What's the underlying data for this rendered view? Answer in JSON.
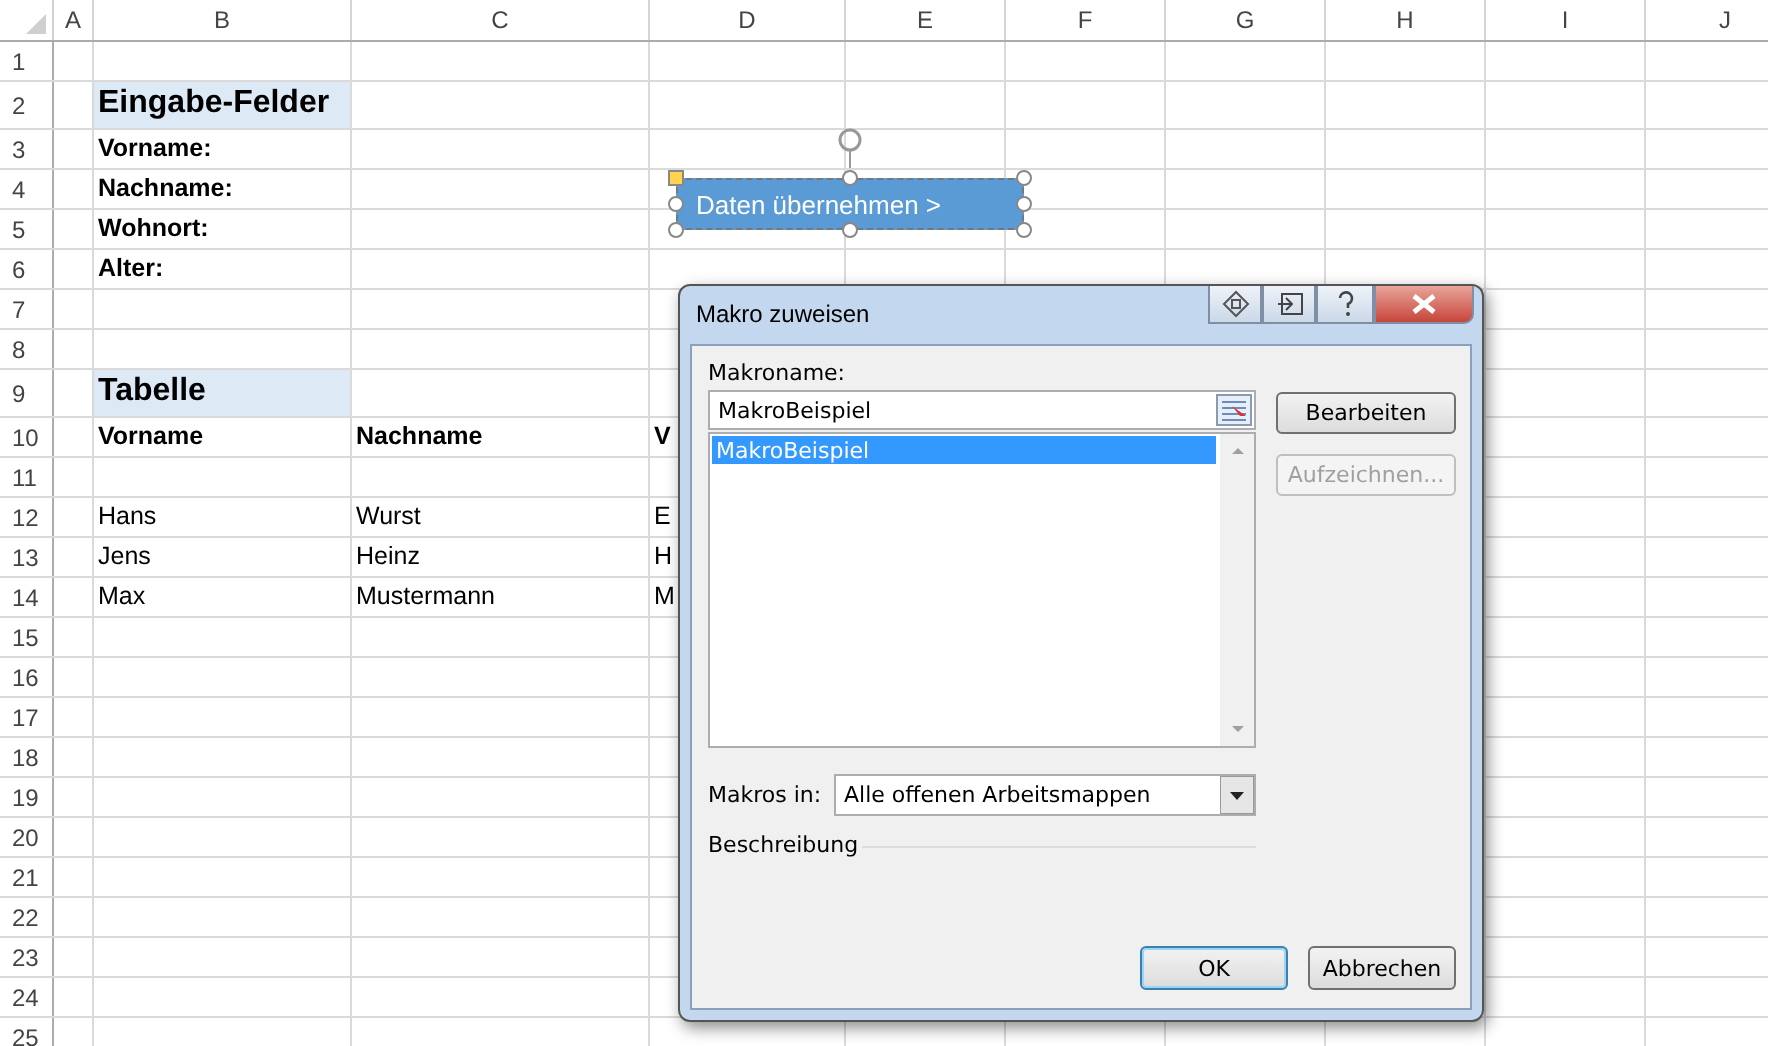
{
  "sheet": {
    "columns": [
      "A",
      "B",
      "C",
      "D",
      "E",
      "F",
      "G",
      "H",
      "I",
      "J"
    ],
    "rows": [
      {
        "number": "1",
        "kind": "plain"
      },
      {
        "number": "2",
        "kind": "heading",
        "b": "Eingabe-Felder"
      },
      {
        "number": "3",
        "kind": "bold",
        "b": "Vorname:"
      },
      {
        "number": "4",
        "kind": "bold",
        "b": "Nachname:"
      },
      {
        "number": "5",
        "kind": "bold",
        "b": "Wohnort:"
      },
      {
        "number": "6",
        "kind": "bold",
        "b": "Alter:"
      },
      {
        "number": "7",
        "kind": "plain"
      },
      {
        "number": "8",
        "kind": "plain"
      },
      {
        "number": "9",
        "kind": "heading",
        "b": "Tabelle"
      },
      {
        "number": "10",
        "kind": "bold",
        "b": "Vorname",
        "c": "Nachname",
        "d": "V"
      },
      {
        "number": "11",
        "kind": "plain"
      },
      {
        "number": "12",
        "kind": "plain",
        "b": "Hans",
        "c": "Wurst",
        "d": "E"
      },
      {
        "number": "13",
        "kind": "plain",
        "b": "Jens",
        "c": "Heinz",
        "d": "H"
      },
      {
        "number": "14",
        "kind": "plain",
        "b": "Max",
        "c": "Mustermann",
        "d": "M"
      },
      {
        "number": "15",
        "kind": "plain"
      },
      {
        "number": "16",
        "kind": "plain"
      },
      {
        "number": "17",
        "kind": "plain"
      },
      {
        "number": "18",
        "kind": "plain"
      },
      {
        "number": "19",
        "kind": "plain"
      },
      {
        "number": "20",
        "kind": "plain"
      },
      {
        "number": "21",
        "kind": "plain"
      },
      {
        "number": "22",
        "kind": "plain"
      },
      {
        "number": "23",
        "kind": "plain"
      },
      {
        "number": "24",
        "kind": "plain"
      },
      {
        "number": "25",
        "kind": "plain"
      }
    ]
  },
  "shape": {
    "label": "Daten übernehmen >",
    "selected": true
  },
  "dialog": {
    "title": "Makro zuweisen",
    "name_label": "Makroname:",
    "name_value": "MakroBeispiel",
    "macros": [
      {
        "name": "MakroBeispiel",
        "selected": true
      }
    ],
    "buttons": [
      {
        "label": "Bearbeiten",
        "disabled": false
      },
      {
        "label": "Aufzeichnen...",
        "disabled": true
      }
    ],
    "location_label": "Makros in:",
    "location_value": "Alle offenen Arbeitsmappen",
    "description_label": "Beschreibung",
    "footer_buttons": [
      {
        "label": "OK",
        "default": true
      },
      {
        "label": "Abbrechen",
        "default": false
      }
    ]
  }
}
